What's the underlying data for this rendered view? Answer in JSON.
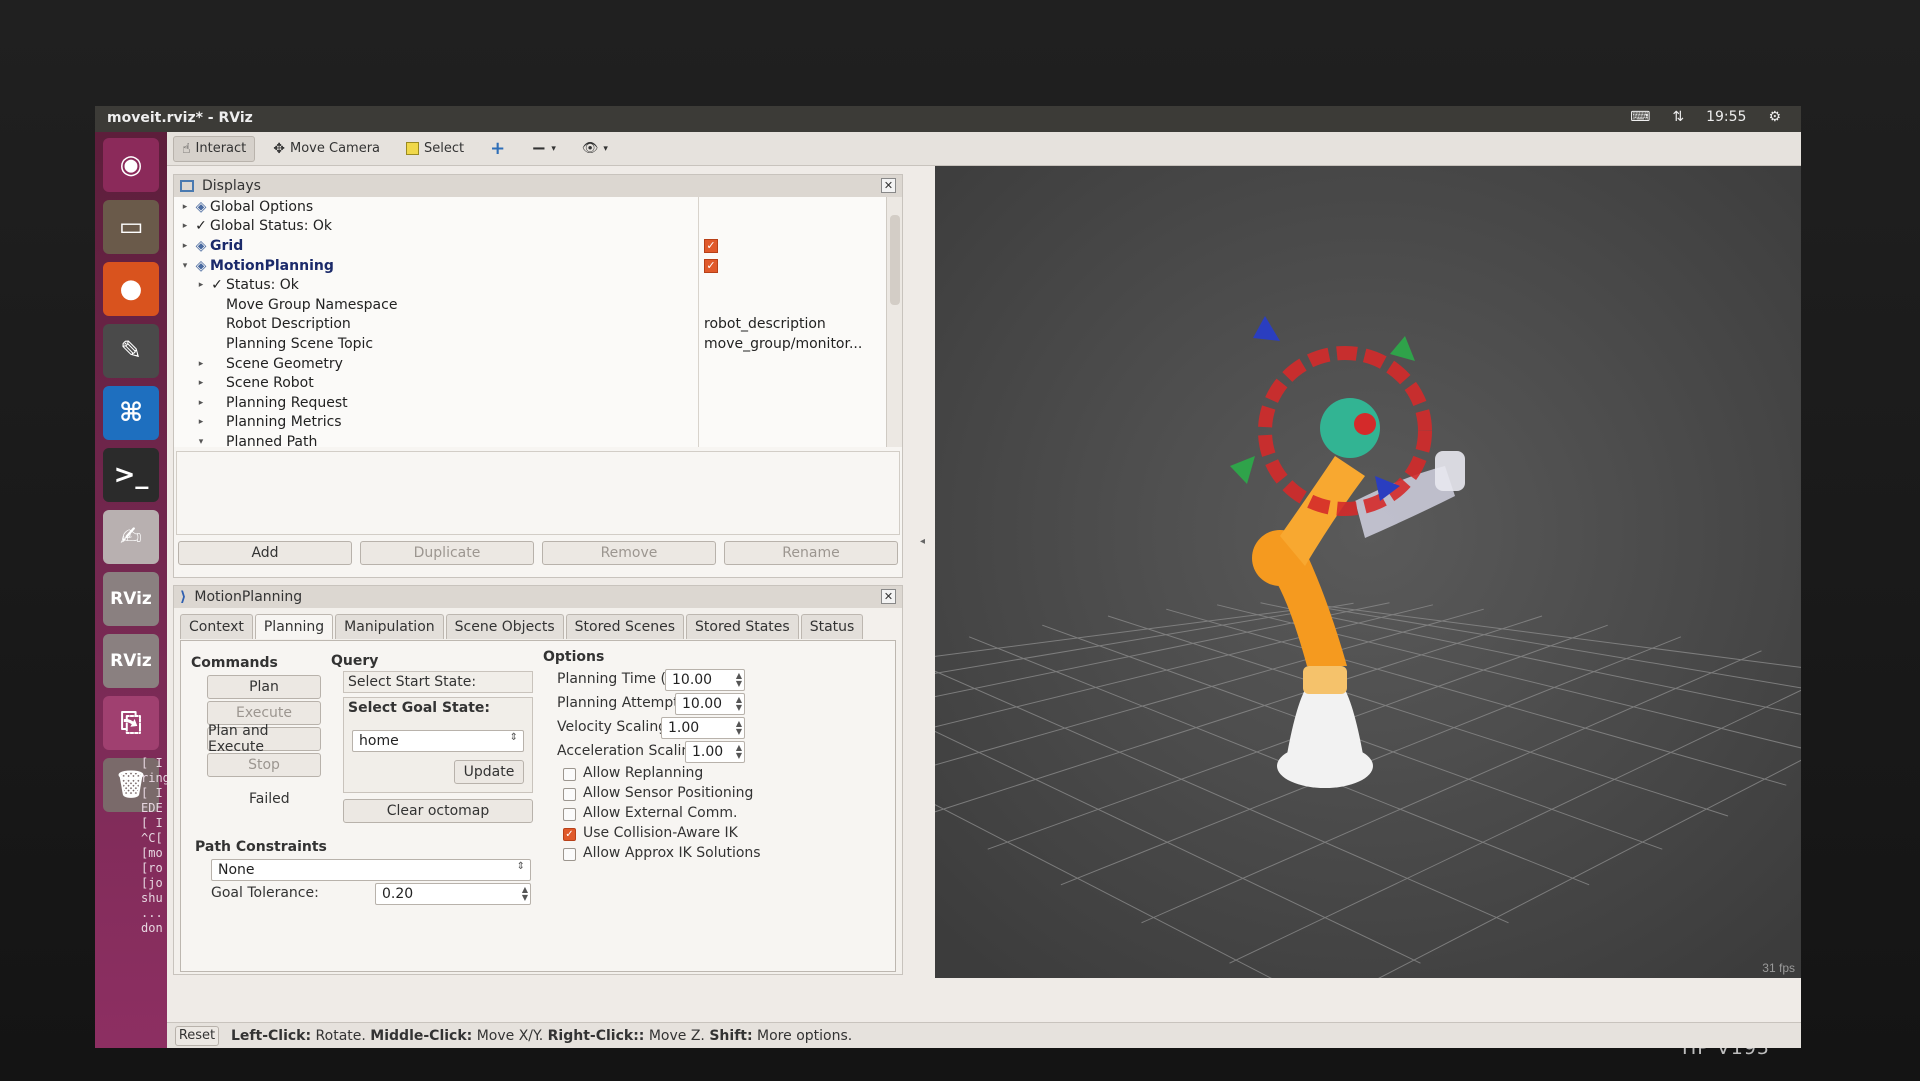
{
  "window_title": "moveit.rviz* - RViz",
  "tray": {
    "keyboard_icon": "keyboard-icon",
    "network_icon": "network-icon",
    "clock": "19:55",
    "settings_icon": "gear-icon"
  },
  "monitor_brand": "HP V195",
  "launcher": [
    {
      "name": "ubuntu-dash-icon",
      "glyph": "◉"
    },
    {
      "name": "files-icon",
      "glyph": "▭"
    },
    {
      "name": "firefox-icon",
      "glyph": "●"
    },
    {
      "name": "settings-tools-icon",
      "glyph": "✎"
    },
    {
      "name": "vscode-icon",
      "glyph": "⌘"
    },
    {
      "name": "terminal-icon",
      "glyph": ">_"
    },
    {
      "name": "text-editor-icon",
      "glyph": "✍"
    },
    {
      "name": "rviz-icon-1",
      "glyph": "RViz"
    },
    {
      "name": "rviz-icon-2",
      "glyph": "RViz"
    },
    {
      "name": "usb-drive-icon",
      "glyph": "⎘"
    },
    {
      "name": "trash-icon",
      "glyph": "🗑"
    }
  ],
  "toolbar": {
    "interact": "Interact",
    "move_camera": "Move Camera",
    "select": "Select",
    "add_icon": "plus-icon",
    "remove_icon": "minus-icon",
    "view_icon": "eye-icon"
  },
  "displays": {
    "title": "Displays",
    "rows": [
      {
        "label": "Global Options",
        "indent": 0,
        "arrow": "▸",
        "value": "",
        "checked": null,
        "bold": false
      },
      {
        "label": "Global Status: Ok",
        "indent": 0,
        "arrow": "▸",
        "value": "",
        "checked": null,
        "bold": false,
        "check_mark": true
      },
      {
        "label": "Grid",
        "indent": 0,
        "arrow": "▸",
        "value": "",
        "checked": true,
        "bold": true
      },
      {
        "label": "MotionPlanning",
        "indent": 0,
        "arrow": "▾",
        "value": "",
        "checked": true,
        "bold": true
      },
      {
        "label": "Status: Ok",
        "indent": 1,
        "arrow": "▸",
        "value": "",
        "checked": null,
        "bold": false,
        "check_mark": true
      },
      {
        "label": "Move Group Namespace",
        "indent": 1,
        "arrow": "",
        "value": "",
        "checked": null,
        "bold": false
      },
      {
        "label": "Robot Description",
        "indent": 1,
        "arrow": "",
        "value": "robot_description",
        "checked": null,
        "bold": false
      },
      {
        "label": "Planning Scene Topic",
        "indent": 1,
        "arrow": "",
        "value": "move_group/monitor...",
        "checked": null,
        "bold": false
      },
      {
        "label": "Scene Geometry",
        "indent": 1,
        "arrow": "▸",
        "value": "",
        "checked": null,
        "bold": false
      },
      {
        "label": "Scene Robot",
        "indent": 1,
        "arrow": "▸",
        "value": "",
        "checked": null,
        "bold": false
      },
      {
        "label": "Planning Request",
        "indent": 1,
        "arrow": "▸",
        "value": "",
        "checked": null,
        "bold": false
      },
      {
        "label": "Planning Metrics",
        "indent": 1,
        "arrow": "▸",
        "value": "",
        "checked": null,
        "bold": false
      },
      {
        "label": "Planned Path",
        "indent": 1,
        "arrow": "▾",
        "value": "",
        "checked": null,
        "bold": false
      }
    ],
    "buttons": {
      "add": "Add",
      "duplicate": "Duplicate",
      "remove": "Remove",
      "rename": "Rename"
    }
  },
  "motion_planning": {
    "title": "MotionPlanning",
    "tabs": [
      "Context",
      "Planning",
      "Manipulation",
      "Scene Objects",
      "Stored Scenes",
      "Stored States",
      "Status"
    ],
    "selected_tab": "Planning",
    "commands": {
      "heading": "Commands",
      "plan": "Plan",
      "execute": "Execute",
      "plan_and_execute": "Plan and Execute",
      "stop": "Stop",
      "result": "Failed"
    },
    "query": {
      "heading": "Query",
      "start_state": "Select Start State:",
      "goal_state": "Select Goal State:",
      "goal_value": "home",
      "update": "Update",
      "clear_octomap": "Clear octomap"
    },
    "options": {
      "heading": "Options",
      "planning_time_label": "Planning Time (s):",
      "planning_time": "10.00",
      "planning_attempts_label": "Planning Attempts:",
      "planning_attempts": "10.00",
      "velocity_scaling_label": "Velocity Scaling:",
      "velocity_scaling": "1.00",
      "acceleration_scaling_label": "Acceleration Scaling:",
      "acceleration_scaling": "1.00",
      "checkboxes": [
        {
          "label": "Allow Replanning",
          "checked": false
        },
        {
          "label": "Allow Sensor Positioning",
          "checked": false
        },
        {
          "label": "Allow External Comm.",
          "checked": false
        },
        {
          "label": "Use Collision-Aware IK",
          "checked": true
        },
        {
          "label": "Allow Approx IK Solutions",
          "checked": false
        }
      ]
    },
    "path_constraints": {
      "heading": "Path Constraints",
      "value": "None",
      "goal_tolerance_label": "Goal Tolerance:",
      "goal_tolerance": "0.20"
    }
  },
  "statusbar": {
    "reset": "Reset",
    "left_click": "Left-Click:",
    "left_action": "Rotate.",
    "middle_click": "Middle-Click:",
    "middle_action": "Move X/Y.",
    "right_click": "Right-Click::",
    "right_action": "Move Z.",
    "shift": "Shift:",
    "shift_action": "More options."
  },
  "viewport": {
    "fps": "31 fps",
    "background": "#4a4a4a",
    "grid_color": "#8a8a8a",
    "robot_colors": {
      "body": "#f59a1f",
      "base": "#f2f2f2",
      "ring": "#d42a2a",
      "arrows": "#2fa34a",
      "ghost": "#d8d8e8"
    }
  },
  "terminal_lines": [
    "[ I",
    "ring",
    "[ I",
    "EDE",
    "[ I",
    "^C[",
    "[mo",
    "[ro",
    "[jo",
    "shu",
    "...",
    "don"
  ]
}
